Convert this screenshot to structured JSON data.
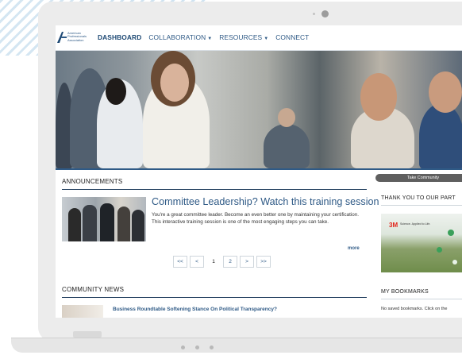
{
  "nav": {
    "logo_text": "American Professionals Association",
    "items": [
      {
        "label": "DASHBOARD",
        "active": true,
        "dropdown": false
      },
      {
        "label": "COLLABORATION",
        "active": false,
        "dropdown": true
      },
      {
        "label": "RESOURCES",
        "active": false,
        "dropdown": true
      },
      {
        "label": "CONNECT",
        "active": false,
        "dropdown": false
      }
    ]
  },
  "announcements": {
    "title": "ANNOUNCEMENTS",
    "headline": "Committee Leadership? Watch this training session",
    "body": "You're a great committee leader. Become an even better one by maintaining your certification. This interactive training session is one of the most engaging steps you can take.",
    "more_label": "more",
    "pager": {
      "first": "<<",
      "prev": "<",
      "pages": [
        "1",
        "2"
      ],
      "current": "1",
      "next": ">",
      "last": ">>"
    }
  },
  "community_news": {
    "title": "COMMUNITY NEWS",
    "item": "Business Roundtable Softening Stance On Political Transparency?"
  },
  "sidebar": {
    "tab_label": "Take Community",
    "sponsors_title": "THANK YOU TO OUR PART",
    "sponsor_brand": "3M",
    "sponsor_tagline": "Science. Applied to Life.",
    "bookmarks_title": "MY BOOKMARKS",
    "bookmarks_text": "No saved bookmarks. Click on the"
  },
  "colors": {
    "brand": "#2f5a86",
    "brand_dark": "#1f4a75",
    "accent_red": "#e2231a"
  }
}
